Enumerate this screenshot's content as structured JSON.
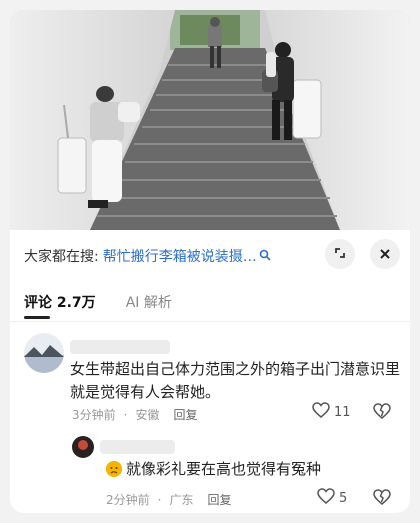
{
  "search": {
    "prefix": "大家都在搜:",
    "query": "帮忙搬行李箱被说装摄…"
  },
  "tabs": [
    {
      "label": "评论 2.7万"
    },
    {
      "label": "AI 解析"
    }
  ],
  "comments": [
    {
      "text": "女生带超出自己体力范围之外的箱子出门潜意识里就是觉得有人会帮她。",
      "time": "3分钟前",
      "location": "安徽",
      "reply_label": "回复",
      "likes": "11"
    },
    {
      "text": "就像彩礼要在高也觉得有冤种",
      "time": "2分钟前",
      "location": "广东",
      "reply_label": "回复",
      "likes": "5"
    }
  ],
  "icons": {
    "search": "search-icon",
    "fullscreen": "expand-icon",
    "close": "close-icon",
    "like": "heart-outline-icon",
    "dislike": "broken-heart-icon",
    "emoji": "sad-face-emoji-icon"
  },
  "colors": {
    "link_blue": "#2a6fc9",
    "muted_gray": "#999999",
    "background": "#f2f2f2"
  }
}
